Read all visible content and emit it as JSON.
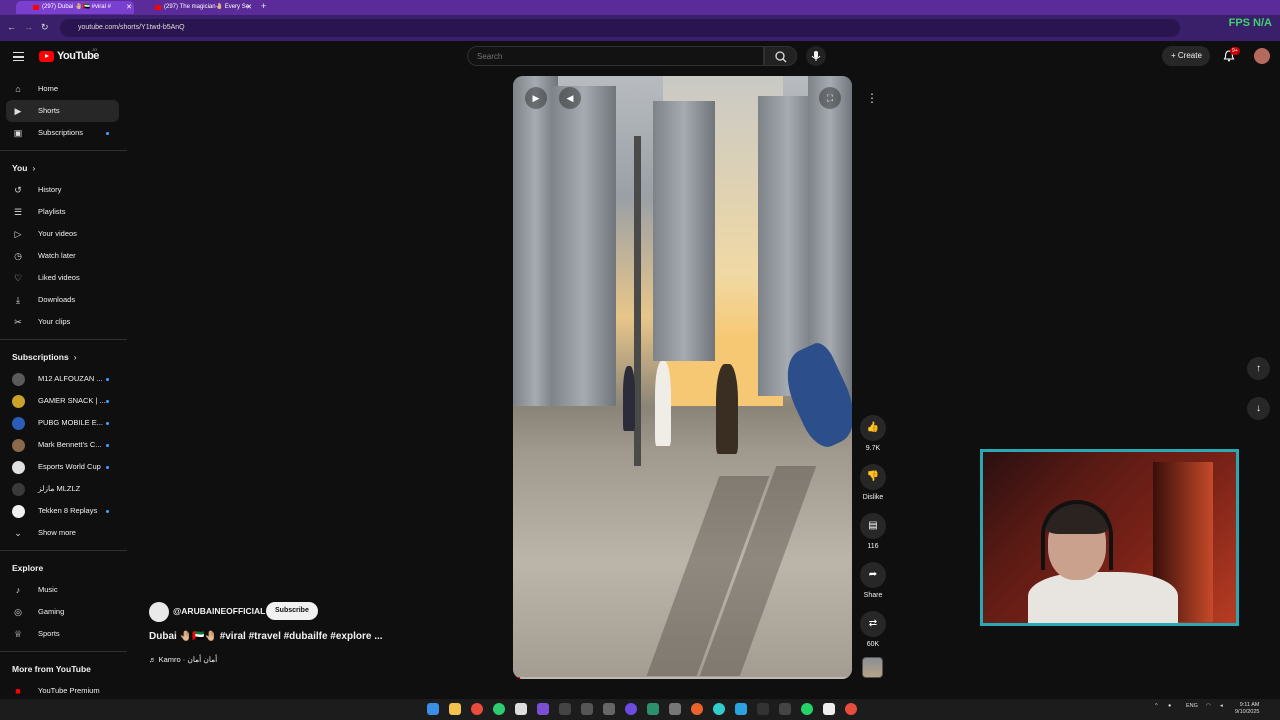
{
  "browser": {
    "tabs": [
      {
        "title": "(297) Dubai 🤚🏼🇦🇪 #viral #",
        "active": true
      },
      {
        "title": "(297) The magician🤚🏼 Every Se",
        "active": false
      }
    ],
    "url": "youtube.com/shorts/Y1twd-b5AnQ",
    "overlay": "FPS N/A"
  },
  "header": {
    "logo_text": "YouTube",
    "logo_sup": "JO",
    "search_placeholder": "Search",
    "create_label": "Create",
    "notif_badge": "9+"
  },
  "sidebar": {
    "main": [
      {
        "label": "Home",
        "icon": "home-icon"
      },
      {
        "label": "Shorts",
        "icon": "shorts-icon",
        "active": true
      },
      {
        "label": "Subscriptions",
        "icon": "subscriptions-icon"
      }
    ],
    "you_heading": "You",
    "you": [
      {
        "label": "History",
        "icon": "history-icon"
      },
      {
        "label": "Playlists",
        "icon": "playlists-icon"
      },
      {
        "label": "Your videos",
        "icon": "your-videos-icon"
      },
      {
        "label": "Watch later",
        "icon": "watch-later-icon"
      },
      {
        "label": "Liked videos",
        "icon": "liked-videos-icon"
      },
      {
        "label": "Downloads",
        "icon": "downloads-icon"
      },
      {
        "label": "Your clips",
        "icon": "clips-icon"
      }
    ],
    "subs_heading": "Subscriptions",
    "subscriptions": [
      {
        "label": "M12 ALFOUZAN ...",
        "color": "#5a5a5a"
      },
      {
        "label": "GAMER SNACK | ...",
        "color": "#c9a227"
      },
      {
        "label": "PUBG MOBILE E...",
        "color": "#2b5cb8"
      },
      {
        "label": "Mark Bennett's C...",
        "color": "#8a6a4a"
      },
      {
        "label": "Esports World Cup",
        "color": "#e0e0e0"
      },
      {
        "label": "مازلز MLZLZ",
        "color": "#3a3a3a"
      },
      {
        "label": "Tekken 8 Replays",
        "color": "#f0f0f0"
      }
    ],
    "show_more": "Show more",
    "explore_heading": "Explore",
    "explore": [
      {
        "label": "Music",
        "icon": "music-icon"
      },
      {
        "label": "Gaming",
        "icon": "gaming-icon"
      },
      {
        "label": "Sports",
        "icon": "sports-icon"
      }
    ],
    "more_heading": "More from YouTube",
    "more": [
      {
        "label": "YouTube Premium",
        "icon": "youtube-premium-icon"
      }
    ]
  },
  "short": {
    "channel": "@ARUBAINEOFFICIAL",
    "subscribe_label": "Subscribe",
    "title": "Dubai 🤚🏼🇦🇪🤚🏼 #viral #travel #dubailfe #explore ...",
    "music": "♬ Kamro · أمان أمان",
    "progress": 0.02
  },
  "actions": {
    "likes": "9.7K",
    "dislike_label": "Dislike",
    "comments": "116",
    "share_label": "Share",
    "remix_count": "60K"
  },
  "taskbar": {
    "lang": "ENG",
    "time": "9:11 AM",
    "date": "9/10/2025"
  }
}
